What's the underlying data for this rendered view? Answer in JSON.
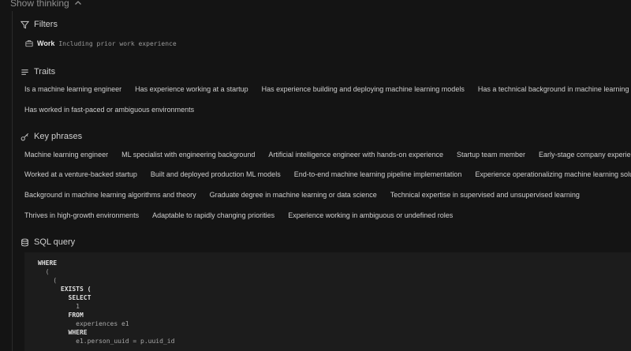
{
  "header": {
    "show_thinking_label": "Show thinking"
  },
  "filters": {
    "title": "Filters",
    "items": [
      {
        "name": "Work",
        "description": "Including prior work experience",
        "icon": "briefcase-icon"
      }
    ]
  },
  "traits": {
    "title": "Traits",
    "rows": [
      [
        "Is a machine learning engineer",
        "Has experience working at a startup",
        "Has experience building and deploying machine learning models",
        "Has a technical background in machine learning"
      ],
      [
        "Has worked in fast-paced or ambiguous environments"
      ]
    ]
  },
  "key_phrases": {
    "title": "Key phrases",
    "rows": [
      [
        "Machine learning engineer",
        "ML specialist with engineering background",
        "Artificial intelligence engineer with hands-on experience",
        "Startup team member",
        "Early-stage company experience"
      ],
      [
        "Worked at a venture-backed startup",
        "Built and deployed production ML models",
        "End-to-end machine learning pipeline implementation",
        "Experience operationalizing machine learning solutions"
      ],
      [
        "Background in machine learning algorithms and theory",
        "Graduate degree in machine learning or data science",
        "Technical expertise in supervised and unsupervised learning"
      ],
      [
        "Thrives in high-growth environments",
        "Adaptable to rapidly changing priorities",
        "Experience working in ambiguous or undefined roles"
      ]
    ]
  },
  "sql_query": {
    "title": "SQL query",
    "lines": [
      "WHERE",
      "  (",
      "    (",
      "      EXISTS (",
      "        SELECT",
      "          1",
      "        FROM",
      "          experiences e1",
      "        WHERE",
      "          e1.person_uuid = p.uuid_id"
    ]
  }
}
